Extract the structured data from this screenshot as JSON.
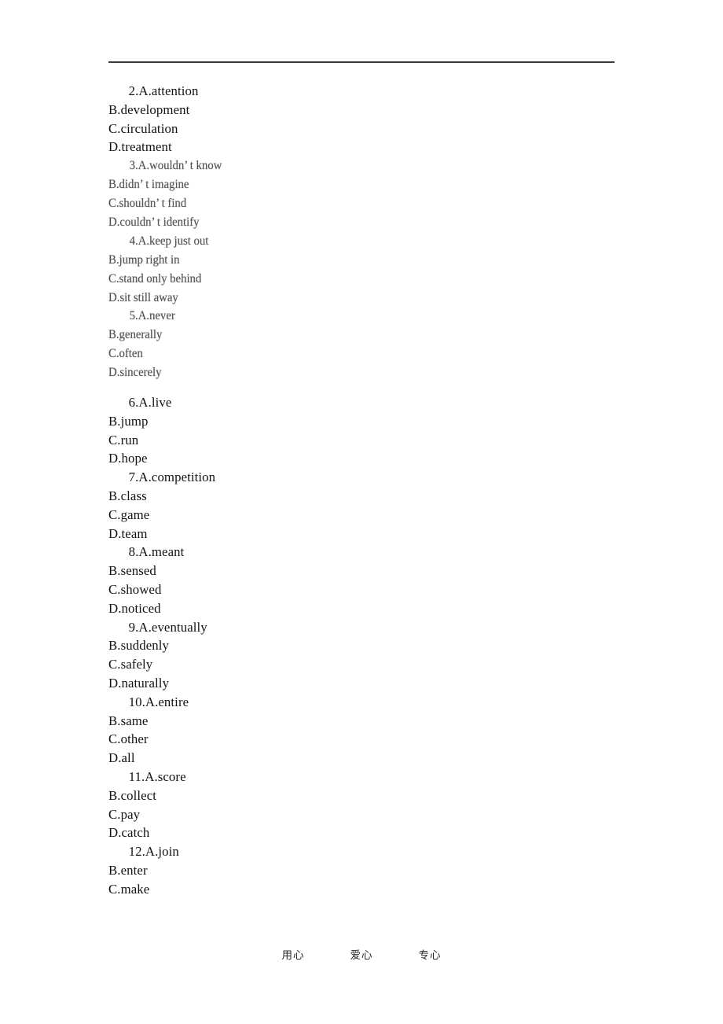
{
  "page": {
    "footer_rule_present": true,
    "background_color": "#ffffff",
    "text_color": "#131313",
    "scan_text_color": "#4a4742"
  },
  "header": {
    "rule_color": "#3a3a3a"
  },
  "questions": [
    {
      "number": "2",
      "style": "digital",
      "lines": [
        "  2.A.attention",
        "B.development",
        "C.circulation",
        "D.treatment"
      ]
    },
    {
      "number": "3",
      "style": "scan",
      "lines": [
        "  3.A.wouldn’ t know",
        "B.didn’ t imagine",
        "C.shouldn’ t find",
        "D.couldn’ t identify"
      ]
    },
    {
      "number": "4",
      "style": "scan",
      "lines": [
        "  4.A.keep just out",
        "B.jump right in",
        "C.stand only behind",
        "D.sit still away"
      ]
    },
    {
      "number": "5",
      "style": "scan",
      "lines": [
        "  5.A.never",
        "B.generally",
        "C.often",
        "D.sincerely"
      ]
    },
    {
      "number": "6",
      "style": "digital",
      "spacer_before": true,
      "lines": [
        "  6.A.live",
        "B.jump",
        "C.run",
        "D.hope"
      ]
    },
    {
      "number": "7",
      "style": "digital",
      "lines": [
        "  7.A.competition",
        "B.class",
        "C.game",
        "D.team"
      ]
    },
    {
      "number": "8",
      "style": "digital",
      "lines": [
        "  8.A.meant",
        "B.sensed",
        "C.showed",
        "D.noticed"
      ]
    },
    {
      "number": "9",
      "style": "digital",
      "lines": [
        "  9.A.eventually",
        "B.suddenly",
        "C.safely",
        "D.naturally"
      ]
    },
    {
      "number": "10",
      "style": "digital",
      "lines": [
        "  10.A.entire",
        "B.same",
        "C.other",
        "D.all"
      ]
    },
    {
      "number": "11",
      "style": "digital",
      "lines": [
        "  11.A.score",
        "B.collect",
        "C.pay",
        "D.catch"
      ]
    },
    {
      "number": "12",
      "style": "digital",
      "lines": [
        "  12.A.join",
        "B.enter",
        "C.make"
      ]
    }
  ],
  "footer": {
    "items": [
      "用心",
      "爱心",
      "专心"
    ]
  }
}
